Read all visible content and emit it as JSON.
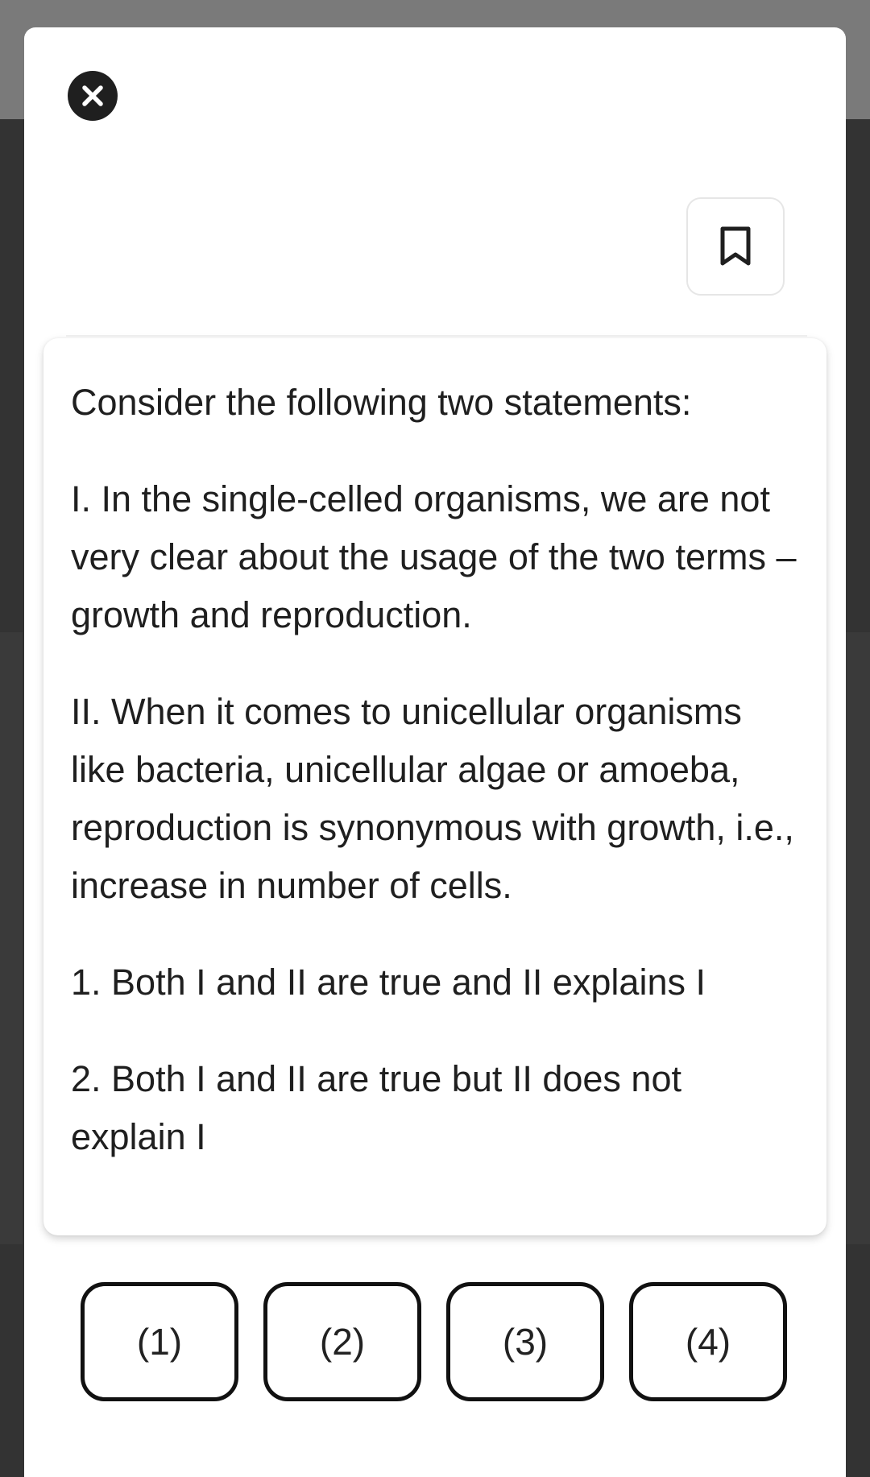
{
  "modal": {
    "close_icon": "close-icon",
    "bookmark_icon": "bookmark-icon"
  },
  "question": {
    "paragraphs": [
      "Consider the following two statements:",
      "I. In the single-celled organisms, we are not very clear about the usage of the two terms – growth and reproduction.",
      "II. When it comes to unicellular organisms like bacteria, unicellular algae or amoeba, reproduction is synonymous with growth, i.e., increase in number of cells.",
      "1. Both I and II are true and II explains I",
      "2. Both I and II are true but II does not explain I"
    ]
  },
  "options": [
    "(1)",
    "(2)",
    "(3)",
    "(4)"
  ]
}
